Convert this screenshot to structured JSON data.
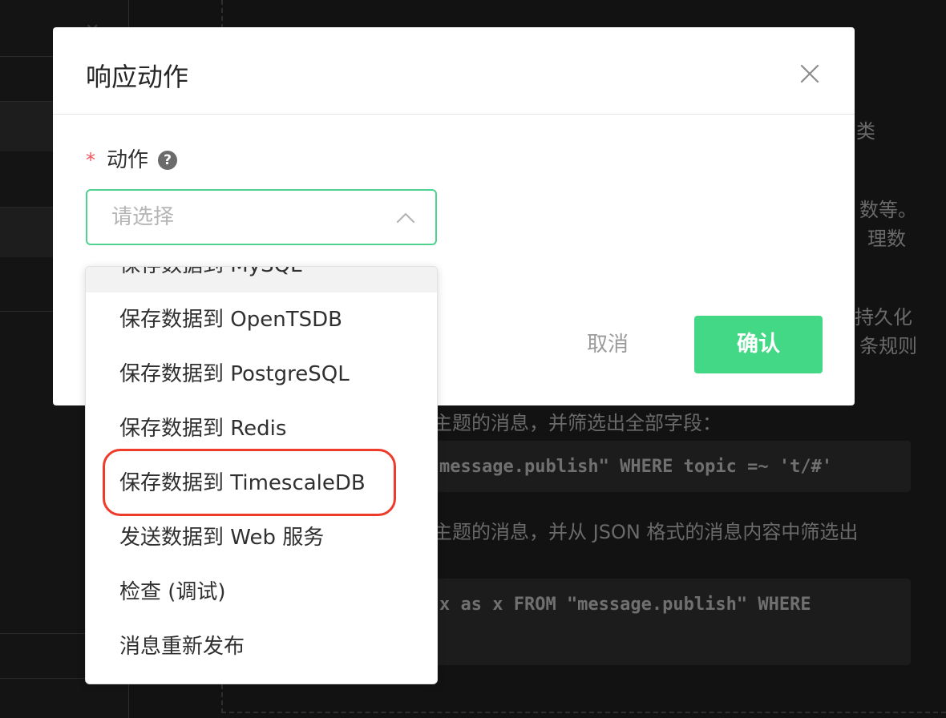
{
  "background": {
    "text_lines": [
      "类",
      "数等。",
      "理数",
      "持久化",
      "条规则",
      "主题的消息，并筛选出全部字段：",
      "主题的消息，并从 JSON 格式的消息内容中筛选出"
    ],
    "code_lines": [
      "message.publish\" WHERE topic =~ 't/#'",
      "x as x FROM \"message.publish\" WHERE"
    ]
  },
  "modal": {
    "title": "响应动作",
    "field_label": "动作",
    "required_mark": "*",
    "help_glyph": "?",
    "select_placeholder": "请选择",
    "cancel_label": "取消",
    "confirm_label": "确认"
  },
  "dropdown": {
    "items": [
      "保存数据到 MySQL",
      "保存数据到 OpenTSDB",
      "保存数据到 PostgreSQL",
      "保存数据到 Redis",
      "保存数据到 TimescaleDB",
      "发送数据到 Web 服务",
      "检查 (调试)",
      "消息重新发布"
    ],
    "highlighted_item": "保存数据到 TimescaleDB"
  },
  "colors": {
    "accent": "#42d885",
    "focus_border": "#4fd18f",
    "required": "#f5555d",
    "highlight_ring": "#ee3b2a"
  }
}
